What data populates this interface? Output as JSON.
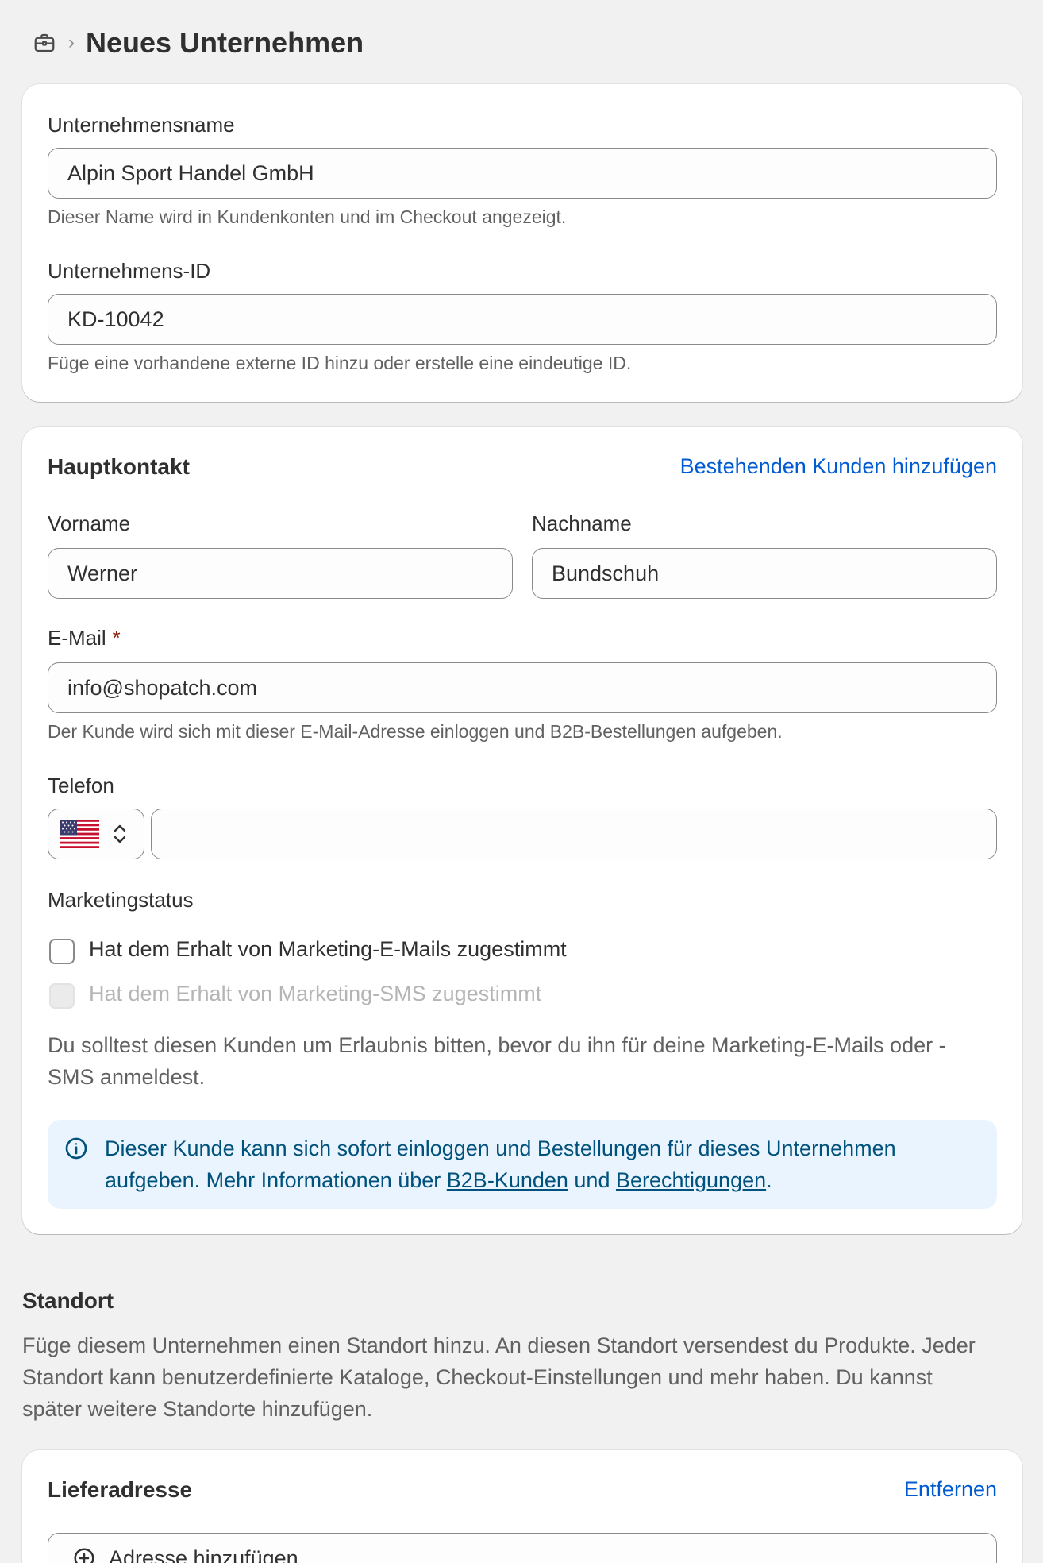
{
  "header": {
    "icon": "briefcase-icon",
    "title": "Neues Unternehmen"
  },
  "company": {
    "name_label": "Unternehmensname",
    "name_value": "Alpin Sport Handel GmbH",
    "name_help": "Dieser Name wird in Kundenkonten und im Checkout angezeigt.",
    "id_label": "Unternehmens-ID",
    "id_value": "KD-10042",
    "id_help": "Füge eine vorhandene externe ID hinzu oder erstelle eine eindeutige ID."
  },
  "contact": {
    "title": "Hauptkontakt",
    "add_existing": "Bestehenden Kunden hinzufügen",
    "first_name_label": "Vorname",
    "first_name_value": "Werner",
    "last_name_label": "Nachname",
    "last_name_value": "Bundschuh",
    "email_label": "E-Mail",
    "email_required": "*",
    "email_value": "info@shopatch.com",
    "email_help": "Der Kunde wird sich mit dieser E-Mail-Adresse einloggen und B2B-Bestellungen aufgeben.",
    "phone_label": "Telefon",
    "phone_country_icon": "us-flag-icon",
    "phone_value": "",
    "marketing_label": "Marketingstatus",
    "marketing_email": "Hat dem Erhalt von Marketing-E-Mails zugestimmt",
    "marketing_sms": "Hat dem Erhalt von Marketing-SMS zugestimmt",
    "marketing_note_1": "Du solltest diesen Kunden um Erlaubnis bitten, bevor du ihn für deine Marketing-E-Mails oder -",
    "marketing_note_2": "SMS anmeldest.",
    "banner_text_1": "Dieser Kunde kann sich sofort einloggen und Bestellungen für dieses Unternehmen",
    "banner_text_2a": "aufgeben. Mehr Informationen über ",
    "banner_link_1": "B2B-Kunden",
    "banner_text_2b": " und ",
    "banner_link_2": "Berechtigungen",
    "banner_text_2c": "."
  },
  "location": {
    "title": "Standort",
    "desc_1": "Füge diesem Unternehmen einen Standort hinzu. An diesen Standort versendest du Produkte. Jeder",
    "desc_2": "Standort kann benutzerdefinierte Kataloge, Checkout-Einstellungen und mehr haben. Du kannst",
    "desc_3": "später weitere Standorte hinzufügen."
  },
  "shipping": {
    "title": "Lieferadresse",
    "remove": "Entfernen",
    "add_address": "Adresse hinzufügen"
  },
  "colors": {
    "link": "#005bd3",
    "banner_bg": "#eaf4ff",
    "banner_text": "#00527c",
    "required": "#8e1f0b"
  }
}
